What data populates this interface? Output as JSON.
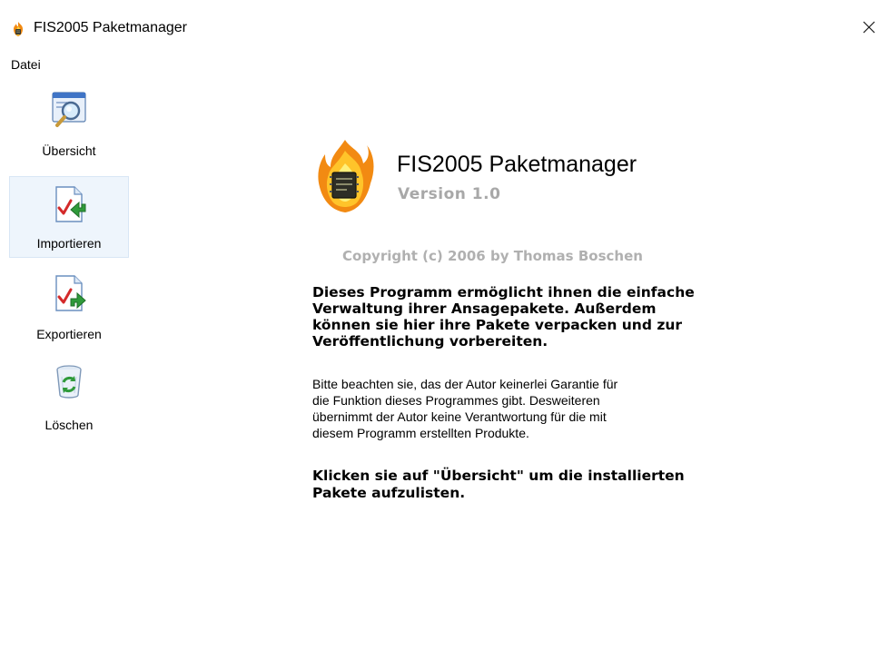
{
  "window": {
    "title": "FIS2005 Paketmanager",
    "icon": "flame-app-icon",
    "close_icon": "close-icon"
  },
  "menubar": {
    "items": [
      {
        "label": "Datei"
      }
    ]
  },
  "sidebar": {
    "selected_color": "#eef5fc",
    "items": [
      {
        "label": "Übersicht",
        "icon": "magnifier-window-icon",
        "selected": false
      },
      {
        "label": "Importieren",
        "icon": "import-checkmark-icon",
        "selected": true
      },
      {
        "label": "Exportieren",
        "icon": "export-checkmark-icon",
        "selected": false
      },
      {
        "label": "Löschen",
        "icon": "recycle-bin-icon",
        "selected": false
      }
    ]
  },
  "main": {
    "logo_icon": "flame-chip-logo",
    "app_name": "FIS2005 Paketmanager",
    "version": "Version 1.0",
    "copyright": "Copyright (c) 2006 by Thomas Boschen",
    "description": "Dieses Programm ermöglicht ihnen die einfache\nVerwaltung ihrer Ansagepakete. Außerdem\nkönnen sie hier ihre Pakete verpacken und zur\nVeröffentlichung vorbereiten.",
    "disclaimer": "Bitte beachten sie, das der Autor keinerlei Garantie für\ndie Funktion dieses Programmes gibt. Desweiteren\nübernimmt der Autor keine Verantwortung für die mit\ndiesem Programm erstellten Produkte.",
    "hint": "Klicken sie auf \"Übersicht\" um die installierten\nPakete aufzulisten.",
    "grey_text_color": "#a8a8a8"
  }
}
